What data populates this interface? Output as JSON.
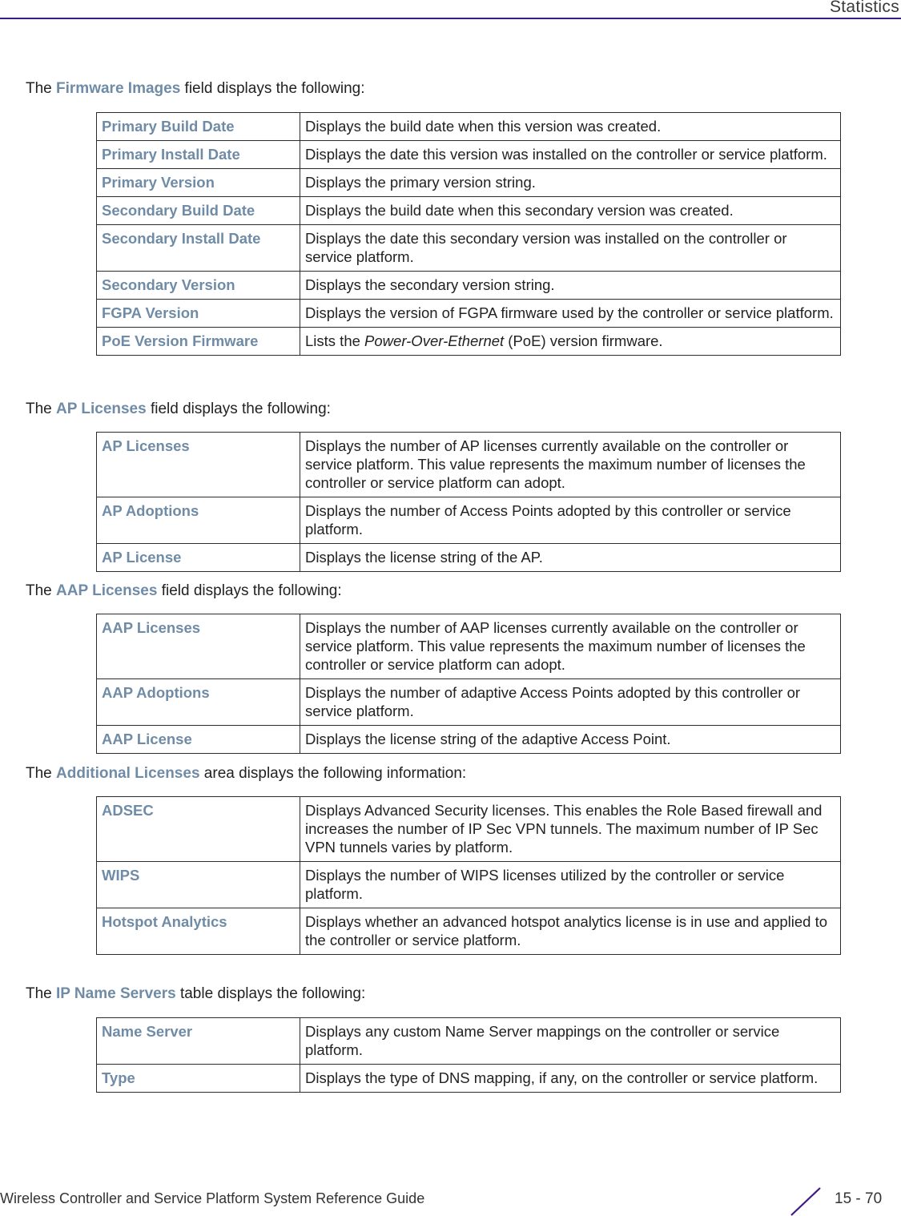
{
  "header": {
    "title": "Statistics"
  },
  "colors": {
    "accent": "#3d1a8a",
    "term": "#6f8ba6"
  },
  "sections": [
    {
      "intro_prefix": "The ",
      "intro_term": "Firmware Images",
      "intro_suffix": " field displays the following:",
      "rows": [
        {
          "term": "Primary Build Date",
          "desc": "Displays the build date when this version was created."
        },
        {
          "term": "Primary Install Date",
          "desc": "Displays the date this version was installed on the controller or service platform."
        },
        {
          "term": "Primary Version",
          "desc": "Displays the primary version string."
        },
        {
          "term": "Secondary Build Date",
          "desc": "Displays the build date when this secondary version was created."
        },
        {
          "term": "Secondary Install Date",
          "desc": "Displays the date this secondary version was installed on the controller or service platform."
        },
        {
          "term": "Secondary Version",
          "desc": "Displays the secondary version string."
        },
        {
          "term": "FGPA Version",
          "desc": "Displays the version of FGPA firmware used by the controller or service platform."
        },
        {
          "term": "PoE Version Firmware",
          "desc_prefix": "Lists the ",
          "desc_em": "Power-Over-Ethernet",
          "desc_suffix": " (PoE) version firmware."
        }
      ]
    },
    {
      "intro_prefix": "The ",
      "intro_term": "AP Licenses",
      "intro_suffix": " field displays the following:",
      "rows": [
        {
          "term": "AP Licenses",
          "desc": "Displays the number of AP licenses currently available on the controller or service platform. This value represents the maximum number of licenses the controller or service platform can adopt."
        },
        {
          "term": "AP Adoptions",
          "desc": "Displays the number of Access Points adopted by this controller or service platform."
        },
        {
          "term": "AP License",
          "desc": "Displays the license string of the AP."
        }
      ]
    },
    {
      "intro_prefix": "The ",
      "intro_term": "AAP Licenses",
      "intro_suffix": " field displays the following:",
      "rows": [
        {
          "term": "AAP Licenses",
          "desc": "Displays the number of AAP licenses currently available on the controller or service platform. This value represents the maximum number of licenses the controller or service platform can adopt."
        },
        {
          "term": "AAP Adoptions",
          "desc": "Displays the number of adaptive Access Points adopted by this controller or service platform."
        },
        {
          "term": "AAP License",
          "desc": "Displays the license string of the adaptive Access Point."
        }
      ]
    },
    {
      "intro_prefix": "The ",
      "intro_term": "Additional Licenses",
      "intro_suffix": " area displays the following information:",
      "rows": [
        {
          "term": "ADSEC",
          "desc": "Displays Advanced Security licenses. This enables the Role Based firewall and increases the number of IP Sec VPN tunnels. The maximum number of IP Sec VPN tunnels varies by platform."
        },
        {
          "term": "WIPS",
          "desc": "Displays the number of WIPS licenses utilized by the controller or service platform."
        },
        {
          "term": "Hotspot Analytics",
          "desc": "Displays whether an advanced hotspot analytics license is in use and applied to the controller or service platform."
        }
      ]
    },
    {
      "intro_prefix": "The ",
      "intro_term": "IP Name Servers",
      "intro_suffix": " table displays the following:",
      "rows": [
        {
          "term": "Name Server",
          "desc": "Displays any custom Name Server mappings on the controller or service platform."
        },
        {
          "term": "Type",
          "desc": "Displays the type of DNS mapping, if any, on the controller or service platform."
        }
      ]
    }
  ],
  "footer": {
    "guide_title": "Wireless Controller and Service Platform System Reference Guide",
    "page_number": "15 - 70"
  }
}
